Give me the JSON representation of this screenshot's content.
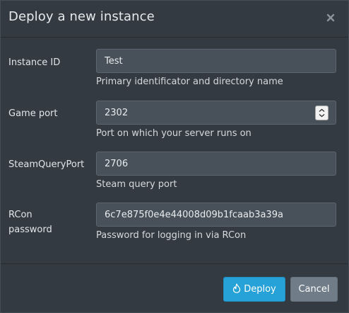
{
  "dialog": {
    "title": "Deploy a new instance"
  },
  "fields": {
    "instance_id": {
      "label": "Instance ID",
      "value": "Test",
      "help": "Primary identificator and directory name"
    },
    "game_port": {
      "label": "Game port",
      "value": "2302",
      "help": "Port on which your server runs on"
    },
    "steam_query_port": {
      "label": "SteamQueryPort",
      "value": "2706",
      "help": "Steam query port"
    },
    "rcon_password": {
      "label_line1": "RCon",
      "label_line2": "password",
      "value": "6c7e875f0e4e44008d09b1fcaab3a39a",
      "help": "Password for logging in via RCon"
    }
  },
  "footer": {
    "deploy_label": "Deploy",
    "cancel_label": "Cancel"
  },
  "icons": {
    "close": "close-icon",
    "deploy": "fire-icon",
    "spinner": "spinner-icon"
  },
  "colors": {
    "background": "#333a41",
    "input_background": "#48515a",
    "primary_button": "#27a2d8",
    "secondary_button": "#707d89"
  }
}
